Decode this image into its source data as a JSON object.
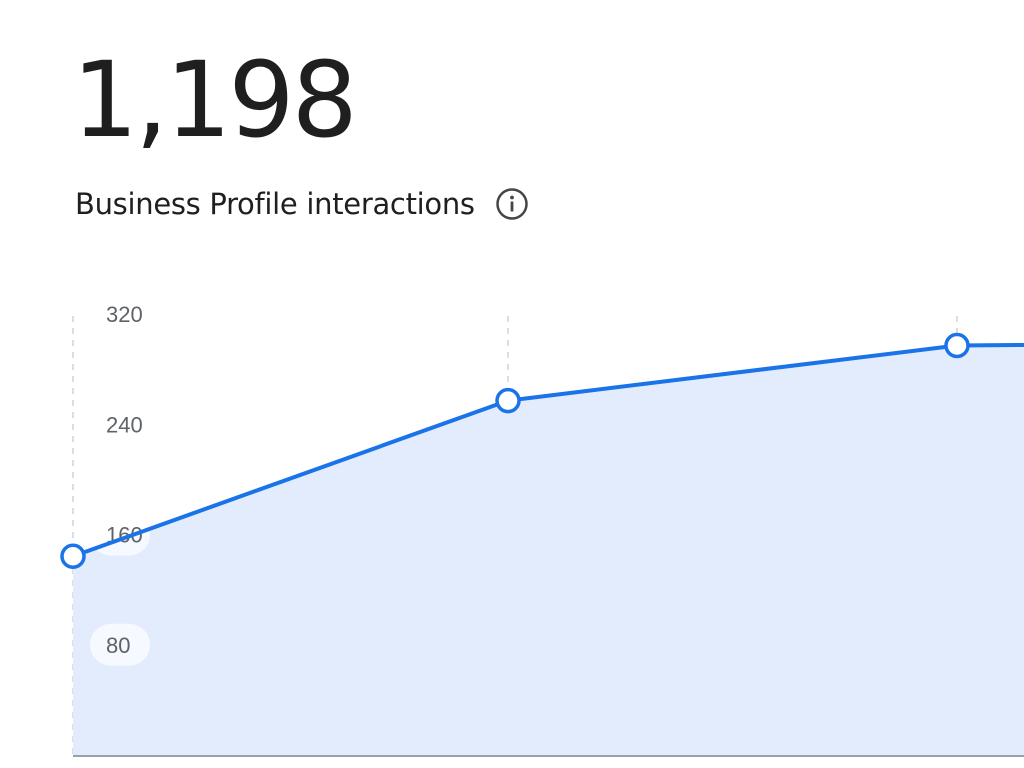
{
  "metric": {
    "value": "1,198",
    "label": "Business Profile interactions",
    "info_icon": "info-icon"
  },
  "colors": {
    "line": "#1a73e8",
    "area": "#e2ecfd",
    "tick_text": "#5f6368",
    "gridline": "#cfd3d8",
    "axis": "#9aa0a6"
  },
  "chart_data": {
    "type": "area",
    "y_ticks": [
      "320",
      "240",
      "160",
      "80"
    ],
    "y_tick_values": [
      320,
      240,
      160,
      80
    ],
    "ylim": [
      0,
      320
    ],
    "series": [
      {
        "values": [
          145,
          258,
          298,
          299
        ]
      }
    ],
    "grid": "vertical dashed"
  }
}
